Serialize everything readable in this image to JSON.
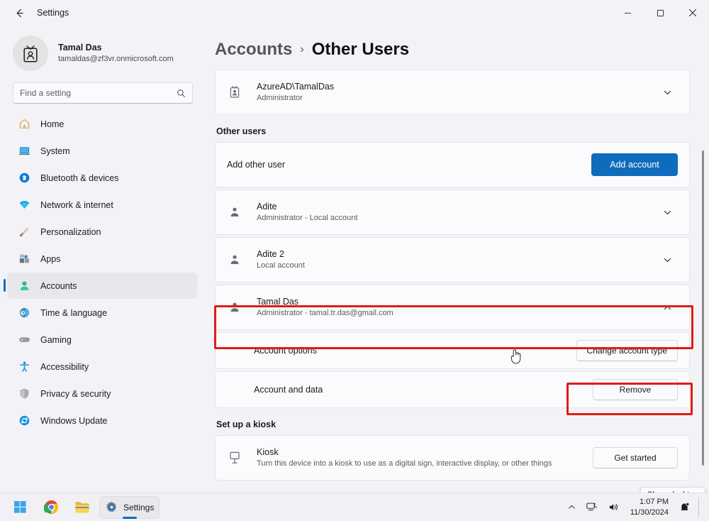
{
  "window": {
    "title": "Settings",
    "back_icon": "back-arrow-icon",
    "minimize_label": "─",
    "maximize_label": "☐",
    "close_label": "✕"
  },
  "sidebar": {
    "profile": {
      "name": "Tamal Das",
      "email": "tamaldas@zf3vr.onmicrosoft.com",
      "avatar_icon": "id-badge-avatar-icon"
    },
    "search": {
      "placeholder": "Find a setting",
      "value": "",
      "icon": "search-icon"
    },
    "items": [
      {
        "label": "Home",
        "icon": "home-icon",
        "active": false
      },
      {
        "label": "System",
        "icon": "system-icon",
        "active": false
      },
      {
        "label": "Bluetooth & devices",
        "icon": "bluetooth-icon",
        "active": false
      },
      {
        "label": "Network & internet",
        "icon": "network-icon",
        "active": false
      },
      {
        "label": "Personalization",
        "icon": "personalization-brush-icon",
        "active": false
      },
      {
        "label": "Apps",
        "icon": "apps-icon",
        "active": false
      },
      {
        "label": "Accounts",
        "icon": "accounts-person-icon",
        "active": true
      },
      {
        "label": "Time & language",
        "icon": "clock-globe-icon",
        "active": false
      },
      {
        "label": "Gaming",
        "icon": "gamepad-icon",
        "active": false
      },
      {
        "label": "Accessibility",
        "icon": "accessibility-person-icon",
        "active": false
      },
      {
        "label": "Privacy & security",
        "icon": "shield-icon",
        "active": false
      },
      {
        "label": "Windows Update",
        "icon": "update-refresh-icon",
        "active": false
      }
    ]
  },
  "breadcrumb": {
    "parent": "Accounts",
    "separator": "›",
    "current": "Other Users"
  },
  "main": {
    "top_account": {
      "name": "AzureAD\\TamalDas",
      "sub": "Administrator",
      "icon": "work-account-icon",
      "chevron": "chevron-down-icon"
    },
    "other_users_label": "Other users",
    "add_user": {
      "label": "Add other user",
      "button": "Add account"
    },
    "users": [
      {
        "name": "Adite",
        "sub": "Administrator - Local account",
        "icon": "person-icon",
        "chevron": "chevron-down-icon",
        "expanded": false
      },
      {
        "name": "Adite 2",
        "sub": "Local account",
        "icon": "person-icon",
        "chevron": "chevron-down-icon",
        "expanded": false
      },
      {
        "name": "Tamal Das",
        "sub": "Administrator - tamal.tr.das@gmail.com",
        "icon": "person-icon",
        "chevron": "chevron-up-icon",
        "expanded": true
      }
    ],
    "expanded_options": [
      {
        "label": "Account options",
        "button": "Change account type"
      },
      {
        "label": "Account and data",
        "button": "Remove"
      }
    ],
    "kiosk_section_label": "Set up a kiosk",
    "kiosk": {
      "name": "Kiosk",
      "sub": "Turn this device into a kiosk to use as a digital sign, interactive display, or other things",
      "icon": "kiosk-monitor-icon",
      "button": "Get started"
    }
  },
  "tooltip": {
    "text": "Show desktop"
  },
  "taskbar": {
    "items": [
      {
        "label": "",
        "icon": "windows-start-icon",
        "active": false
      },
      {
        "label": "",
        "icon": "chrome-icon",
        "active": false
      },
      {
        "label": "",
        "icon": "file-explorer-icon",
        "active": false
      },
      {
        "label": "Settings",
        "icon": "settings-gear-icon",
        "active": true
      }
    ],
    "tray": {
      "chevron_icon": "chevron-up-icon",
      "network_icon": "network-tray-icon",
      "volume_icon": "volume-icon",
      "notification_icon": "notification-bell-icon",
      "time": "1:07 PM",
      "date": "11/30/2024"
    }
  },
  "colors": {
    "accent": "#0f6cbd",
    "annotation": "#e01b18",
    "card": "#fbfbfd",
    "background": "#f3f3f7"
  }
}
